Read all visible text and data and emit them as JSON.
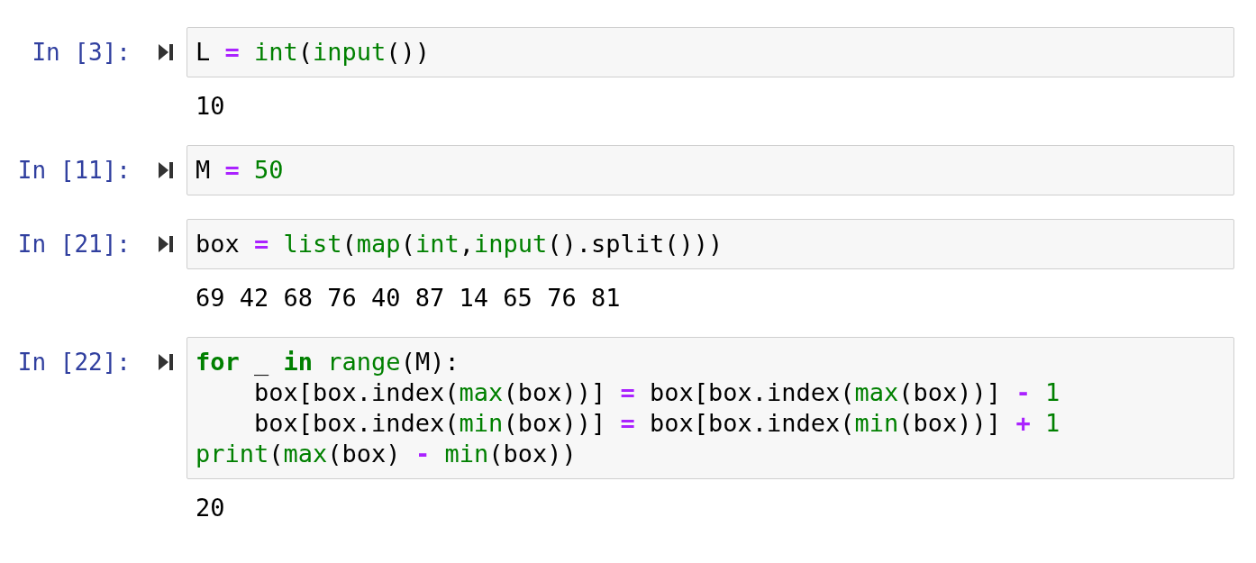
{
  "cells": [
    {
      "prompt": "In [3]:",
      "code": [
        [
          {
            "kind": "text",
            "text": "L "
          },
          {
            "kind": "op",
            "text": "= "
          },
          {
            "kind": "builtin",
            "text": "int"
          },
          {
            "kind": "text",
            "text": "("
          },
          {
            "kind": "builtin",
            "text": "input"
          },
          {
            "kind": "text",
            "text": "())"
          }
        ]
      ],
      "output": "10"
    },
    {
      "prompt": "In [11]:",
      "code": [
        [
          {
            "kind": "text",
            "text": "M "
          },
          {
            "kind": "op",
            "text": "= "
          },
          {
            "kind": "num",
            "text": "50"
          }
        ]
      ]
    },
    {
      "prompt": "In [21]:",
      "code": [
        [
          {
            "kind": "text",
            "text": "box "
          },
          {
            "kind": "op",
            "text": "= "
          },
          {
            "kind": "builtin",
            "text": "list"
          },
          {
            "kind": "text",
            "text": "("
          },
          {
            "kind": "builtin",
            "text": "map"
          },
          {
            "kind": "text",
            "text": "("
          },
          {
            "kind": "builtin",
            "text": "int"
          },
          {
            "kind": "text",
            "text": ","
          },
          {
            "kind": "builtin",
            "text": "input"
          },
          {
            "kind": "text",
            "text": "().split()))"
          }
        ]
      ],
      "output": "69 42 68 76 40 87 14 65 76 81"
    },
    {
      "prompt": "In [22]:",
      "code": [
        [
          {
            "kind": "keyword",
            "text": "for"
          },
          {
            "kind": "text",
            "text": " _ "
          },
          {
            "kind": "keyword",
            "text": "in "
          },
          {
            "kind": "builtin",
            "text": "range"
          },
          {
            "kind": "text",
            "text": "(M):"
          }
        ],
        [
          {
            "kind": "text",
            "text": "    box[box.index("
          },
          {
            "kind": "builtin",
            "text": "max"
          },
          {
            "kind": "text",
            "text": "(box))] "
          },
          {
            "kind": "op",
            "text": "="
          },
          {
            "kind": "text",
            "text": " box[box.index("
          },
          {
            "kind": "builtin",
            "text": "max"
          },
          {
            "kind": "text",
            "text": "(box))] "
          },
          {
            "kind": "op",
            "text": "- "
          },
          {
            "kind": "num",
            "text": "1"
          }
        ],
        [
          {
            "kind": "text",
            "text": "    box[box.index("
          },
          {
            "kind": "builtin",
            "text": "min"
          },
          {
            "kind": "text",
            "text": "(box))] "
          },
          {
            "kind": "op",
            "text": "="
          },
          {
            "kind": "text",
            "text": " box[box.index("
          },
          {
            "kind": "builtin",
            "text": "min"
          },
          {
            "kind": "text",
            "text": "(box))] "
          },
          {
            "kind": "op",
            "text": "+ "
          },
          {
            "kind": "num",
            "text": "1"
          }
        ],
        [
          {
            "kind": "builtin",
            "text": "print"
          },
          {
            "kind": "text",
            "text": "("
          },
          {
            "kind": "builtin",
            "text": "max"
          },
          {
            "kind": "text",
            "text": "(box) "
          },
          {
            "kind": "op",
            "text": "- "
          },
          {
            "kind": "builtin",
            "text": "min"
          },
          {
            "kind": "text",
            "text": "(box))"
          }
        ]
      ],
      "output": "20"
    }
  ]
}
